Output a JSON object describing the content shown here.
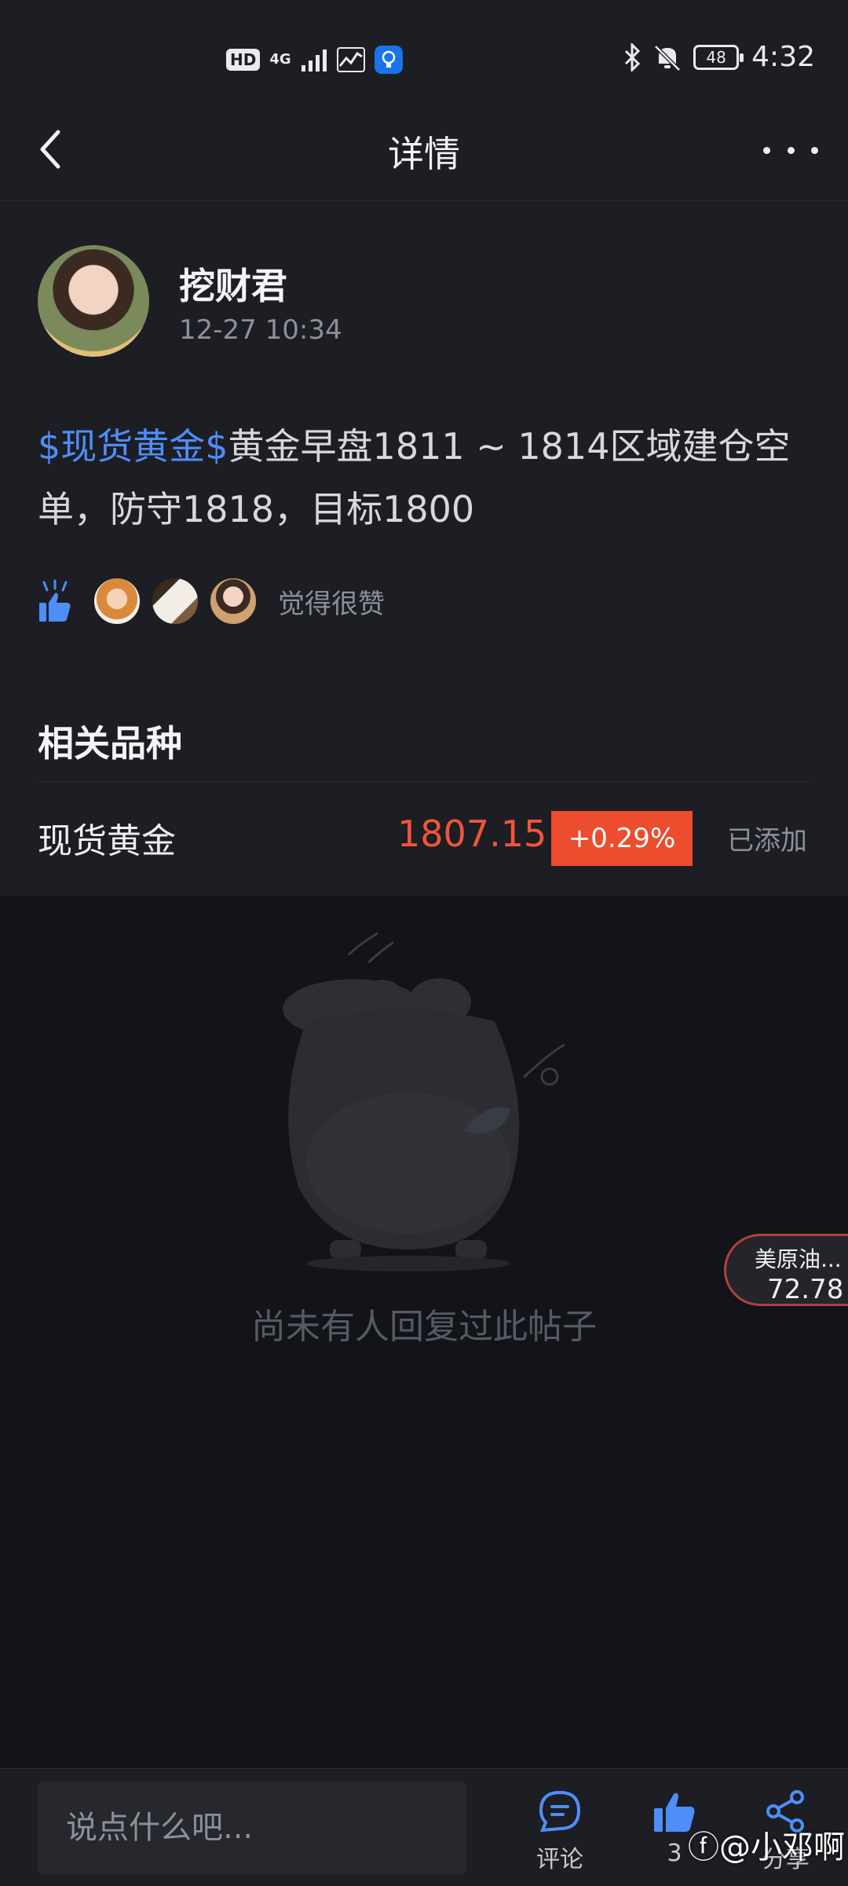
{
  "status_bar": {
    "hd": "HD",
    "network": "4G",
    "battery": "48",
    "time": "4:32"
  },
  "nav": {
    "title": "详情"
  },
  "post": {
    "author": "挖财君",
    "time": "12-27 10:34",
    "tag": "$现货黄金$",
    "body": "黄金早盘1811 ~ 1814区域建仓空单，防守1818，目标1800",
    "likes_text": "觉得很赞"
  },
  "related": {
    "title": "相关品种",
    "items": [
      {
        "name": "现货黄金",
        "price": "1807.15",
        "change": "+0.29%",
        "action": "已添加"
      }
    ]
  },
  "empty": {
    "text": "尚未有人回复过此帖子"
  },
  "float_ticker": {
    "name": "美原油...",
    "value": "72.78"
  },
  "bottom_bar": {
    "comment_placeholder": "说点什么吧...",
    "comment_label": "评论",
    "like_count": "3",
    "share_label": "分享"
  },
  "watermark": "@小邓啊",
  "colors": {
    "background": "#121419",
    "card": "#1c1e24",
    "accent_blue": "#4f8ef7",
    "price_red": "#f0553a",
    "badge_red": "#eb4d2e"
  }
}
